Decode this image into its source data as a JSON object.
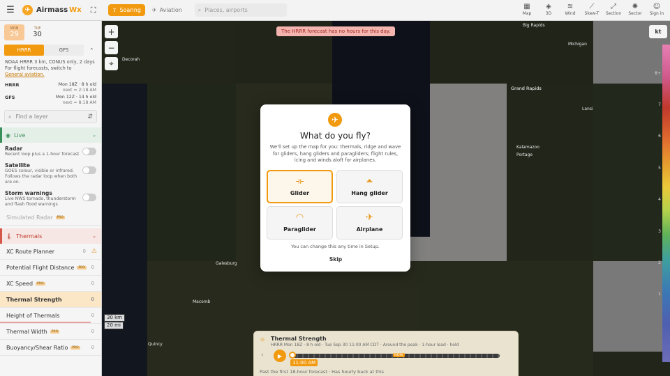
{
  "topbar": {
    "menu_icon": "hamburger-icon",
    "brand_name": "Airmass",
    "brand_suffix": "Wx",
    "tabs": [
      {
        "label": "Soaring",
        "icon": "thermal-icon",
        "active": true
      },
      {
        "label": "Aviation",
        "icon": "airplane-icon",
        "active": false
      }
    ],
    "search_placeholder": "Places, airports",
    "nav": [
      {
        "label": "Map",
        "icon": "map-icon"
      },
      {
        "label": "3D",
        "icon": "cube-icon"
      },
      {
        "label": "Wind",
        "icon": "wind-icon"
      },
      {
        "label": "Skew-T",
        "icon": "skewt-icon"
      },
      {
        "label": "Section",
        "icon": "section-icon"
      },
      {
        "label": "Sector",
        "icon": "sector-icon"
      },
      {
        "label": "Sign in",
        "icon": "user-icon"
      }
    ]
  },
  "sidebar": {
    "dates": [
      {
        "weekday": "MON",
        "day": "29",
        "selected": true
      },
      {
        "weekday": "TUE",
        "day": "30",
        "badge": "NEW",
        "selected": false
      }
    ],
    "models": {
      "active": "HRRR",
      "other": "GFS"
    },
    "model_info": "NOAA HRRR 3 km, CONUS only, 2 days",
    "model_info2": "For flight forecasts, switch to",
    "model_link": "General aviation.",
    "runs": [
      {
        "name": "HRRR",
        "run": "Mon 18Z · 8 h old",
        "next": "next ≈ 2:18 AM"
      },
      {
        "name": "GFS",
        "run": "Mon 12Z · 14 h old",
        "next": "next ≈ 8:18 AM"
      }
    ],
    "layer_search_placeholder": "Find a layer",
    "live_section": "Live",
    "live_layers": [
      {
        "title": "Radar",
        "desc": "Recent loop plus a 1-hour forecast"
      },
      {
        "title": "Satellite",
        "desc": "GOES colour, visible or infrared. Follows the radar loop when both are on."
      },
      {
        "title": "Storm warnings",
        "desc": "Live NWS tornado, thunderstorm and flash flood warnings"
      }
    ],
    "simulated_radar": "Simulated Radar",
    "pro_tag": "PRO",
    "thermals_section": "Thermals",
    "thermal_layers": [
      {
        "label": "XC Route Planner",
        "value": "0",
        "warn": true
      },
      {
        "label": "Potential Flight Distance",
        "value": "0",
        "pro": true
      },
      {
        "label": "XC Speed",
        "value": "0",
        "pro": true
      },
      {
        "label": "Thermal Strength",
        "value": "0",
        "selected": true
      },
      {
        "label": "Height of Thermals",
        "value": "0"
      },
      {
        "label": "Thermal Width",
        "value": "0",
        "pro": true
      },
      {
        "label": "Buoyancy/Shear Ratio",
        "value": "0",
        "pro": true
      }
    ]
  },
  "map": {
    "toast": "The HRRR forecast has no hours for this day.",
    "unit": "kt",
    "scale_km": "30 km",
    "scale_mi": "20 mi",
    "cities": [
      {
        "name": "Grand Rapids",
        "big": true
      },
      {
        "name": "Lansi",
        "big": false
      },
      {
        "name": "Kalamazoo",
        "big": false
      },
      {
        "name": "Portage",
        "big": false
      },
      {
        "name": "Michigan",
        "big": false
      },
      {
        "name": "Big Rapids",
        "big": false
      },
      {
        "name": "Decorah",
        "big": false
      },
      {
        "name": "Galesburg",
        "big": false
      },
      {
        "name": "Macomb",
        "big": false
      },
      {
        "name": "Quincy",
        "big": false
      }
    ],
    "colorbar_labels": [
      "8+",
      "7",
      "6",
      "5",
      "4",
      "3",
      "2",
      "1"
    ]
  },
  "timeline": {
    "title": "Thermal Strength",
    "subtitle": "HRRR Mon 18Z · 8 h old · Tue Sep 30 11:00 AM CDT · Around the peak · 1-hour lead · hold",
    "now_badge": "NOW",
    "time_label": "11:00 AM",
    "footer": "Past the first 18-hour forecast · Has hourly back at this"
  },
  "modal": {
    "title": "What do you fly?",
    "description": "We'll set up the map for you: thermals, ridge and wave for gliders, hang gliders and paragliders; flight rules, icing and winds aloft for airplanes.",
    "options": [
      {
        "label": "Glider",
        "icon": "glider-icon",
        "selected": true
      },
      {
        "label": "Hang glider",
        "icon": "hang-glider-icon",
        "selected": false
      },
      {
        "label": "Paraglider",
        "icon": "paraglider-icon",
        "selected": false
      },
      {
        "label": "Airplane",
        "icon": "airplane-icon",
        "selected": false
      }
    ],
    "note": "You can change this any time in Setup.",
    "skip": "Skip"
  }
}
